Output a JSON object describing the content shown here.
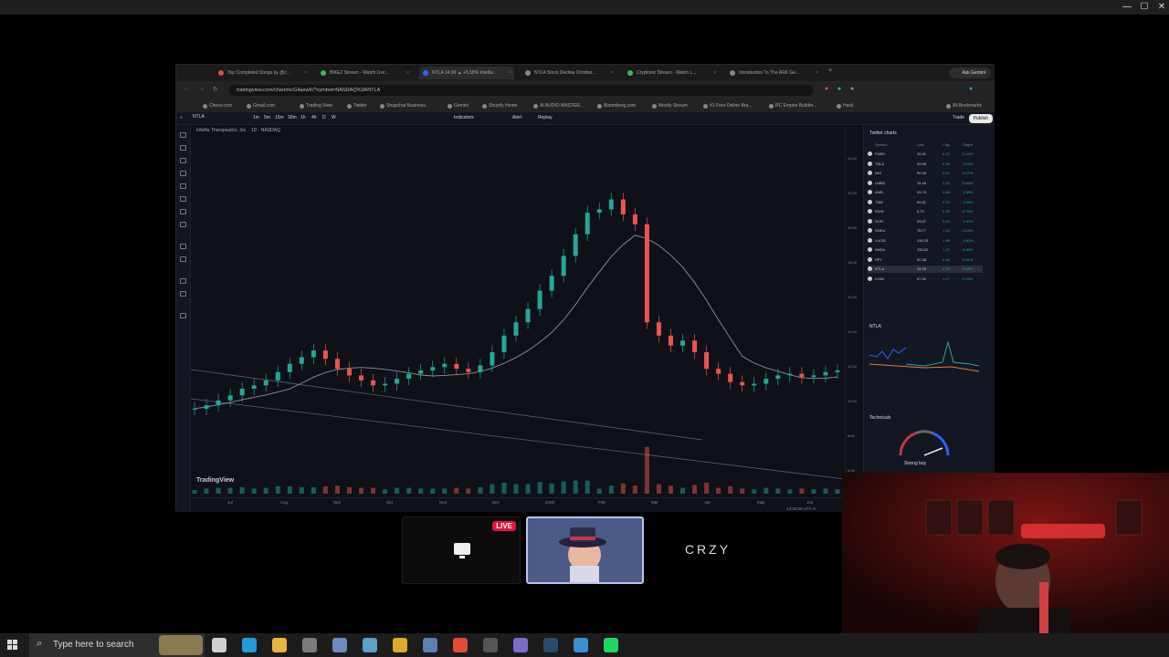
{
  "window": {
    "minimize": "—",
    "maximize": "☐",
    "close": "✕"
  },
  "browser": {
    "tabs": [
      {
        "label": "Top Completed Songs by @c...",
        "color": "#e04b3a"
      },
      {
        "label": "BIKE2 Stream - Watch Live...",
        "color": "#3fb950"
      },
      {
        "label": "NTLA 14.99 ▲ +5.58% Intellia...",
        "color": "#2962ff"
      },
      {
        "label": "NTLA Stock Decline October...",
        "color": "#888888"
      },
      {
        "label": "Cryptonic Stream - Watch L...",
        "color": "#3fb950"
      },
      {
        "label": "Introduction To The ARK Ge...",
        "color": "#888888"
      }
    ],
    "ask_label": "Ask Gemini",
    "url": "tradingview.com/chart/mcG4aewK/?symbol=NASDAQ%3ANTLA",
    "bookmarks": [
      "Chess.com",
      "Gmail.com",
      "Trading View",
      "Twitter",
      "Snapchat Business...",
      "Gemini",
      "Shopify Home",
      "AI AUDIO MASTER...",
      "Bloomberg.com",
      "Mostly Stream",
      "#1 Free Online Bra...",
      "RC Empire Builder...",
      "Hack"
    ],
    "bookmarks_all": "All Bookmarks"
  },
  "tv": {
    "symbol": "NTLA",
    "timeframes": [
      "1m",
      "5m",
      "15m",
      "30m",
      "1h",
      "4h",
      "D",
      "W"
    ],
    "indicators_label": "Indicators",
    "alert_label": "Alert",
    "replay_label": "Replay",
    "trade_label": "Trade",
    "publish_label": "Publish",
    "instrument": "Intellia Therapeutics, Inc. · 1D · NASDAQ",
    "logo": "TradingView",
    "x_ticks": [
      "Jul",
      "Aug",
      "Sep",
      "Oct",
      "Nov",
      "Dec",
      "2025",
      "Feb",
      "Mar",
      "Apr",
      "May",
      "Jun"
    ],
    "y_ticks": [
      "24.00",
      "22.00",
      "20.00",
      "18.00",
      "16.00",
      "14.00",
      "12.00",
      "10.00",
      "8.00",
      "6.00",
      "4.00"
    ],
    "footer_time": "13:25:58 UTC-5",
    "watchlist_title": "Twitter charts",
    "watchlist_cols": [
      "Symbol",
      "Last",
      "Chg",
      "Chg%"
    ],
    "watchlist": [
      {
        "sym": "FUBO",
        "price": "10.01",
        "chg": "0.21",
        "chgp": "2.14%"
      },
      {
        "sym": "TSLA",
        "price": "29.08",
        "chg": "0.35",
        "chgp": "1.22%"
      },
      {
        "sym": "NIO",
        "price": "90.33",
        "chg": "0.51",
        "chgp": "0.57%"
      },
      {
        "sym": "LMND",
        "price": "14.45",
        "chg": "0.12",
        "chgp": "0.84%"
      },
      {
        "sym": "AMD",
        "price": "33.79",
        "chg": "0.46",
        "chgp": "1.38%"
      },
      {
        "sym": "TSM",
        "price": "69.51",
        "chg": "0.72",
        "chgp": "1.05%"
      },
      {
        "sym": "RIVN",
        "price": "6.73",
        "chg": "0.05",
        "chgp": "0.75%"
      },
      {
        "sym": "SOFI",
        "price": "33.57",
        "chg": "0.43",
        "chgp": "1.30%"
      },
      {
        "sym": "ROKU",
        "price": "78.77",
        "chg": "1.12",
        "chgp": "1.44%"
      },
      {
        "sym": "LUCID",
        "price": "134.33",
        "chg": "1.98",
        "chgp": "1.50%"
      },
      {
        "sym": "NVDA",
        "price": "135.52",
        "chg": "1.21",
        "chgp": "0.90%"
      },
      {
        "sym": "SPY",
        "price": "90.38",
        "chg": "0.46",
        "chgp": "0.51%"
      },
      {
        "sym": "NTLA",
        "price": "14.99",
        "chg": "0.79",
        "chgp": "5.58%"
      },
      {
        "sym": "COIN",
        "price": "57.90",
        "chg": "1.27",
        "chgp": "2.24%"
      }
    ],
    "detail_symbol": "NTLA",
    "technicals_title": "Technicals",
    "gauge_text": "Strong buy"
  },
  "stream": {
    "live_badge": "LIVE",
    "brand": "CRZY"
  },
  "taskbar": {
    "search_placeholder": "Type here to search",
    "apps": [
      {
        "name": "task-view-icon",
        "color": "#cfcfcf"
      },
      {
        "name": "edge-icon",
        "color": "#1f9bd7"
      },
      {
        "name": "file-explorer-icon",
        "color": "#e8b53d"
      },
      {
        "name": "calculator-icon",
        "color": "#7a7a7a"
      },
      {
        "name": "app-icon",
        "color": "#6e8bbf"
      },
      {
        "name": "photos-icon",
        "color": "#5aa0c8"
      },
      {
        "name": "chrome-alt-icon",
        "color": "#e0a82e"
      },
      {
        "name": "app-notepad-icon",
        "color": "#5d7fb3"
      },
      {
        "name": "chrome-icon",
        "color": "#e04b3a"
      },
      {
        "name": "obs-icon",
        "color": "#555555"
      },
      {
        "name": "discord-icon",
        "color": "#7a6cc8"
      },
      {
        "name": "steam-icon",
        "color": "#2a4a6e"
      },
      {
        "name": "app-blue-icon",
        "color": "#3a8fd1"
      },
      {
        "name": "spotify-icon",
        "color": "#1ed760"
      }
    ]
  },
  "chart_data": {
    "type": "line",
    "title": "",
    "series": [
      {
        "values": [
          7.8,
          8.0,
          8.3,
          8.6,
          9.0,
          9.2,
          9.5,
          10.0,
          10.5,
          10.9,
          11.3,
          10.8,
          10.2,
          9.8,
          9.5,
          9.2,
          9.3,
          9.6,
          9.9,
          10.1,
          10.3,
          10.5,
          10.2,
          10.0,
          10.4,
          11.2,
          12.2,
          13.0,
          13.8,
          14.9,
          15.8,
          17.0,
          18.3,
          19.6,
          19.8,
          20.4,
          19.5,
          18.9,
          13.0,
          12.2,
          11.6,
          11.9,
          11.2,
          10.2,
          9.9,
          9.4,
          9.2,
          9.3,
          9.6,
          9.8,
          9.9,
          9.7,
          9.8,
          10.0,
          10.1
        ]
      }
    ],
    "ylim": [
      4,
      24
    ],
    "grid": false
  }
}
